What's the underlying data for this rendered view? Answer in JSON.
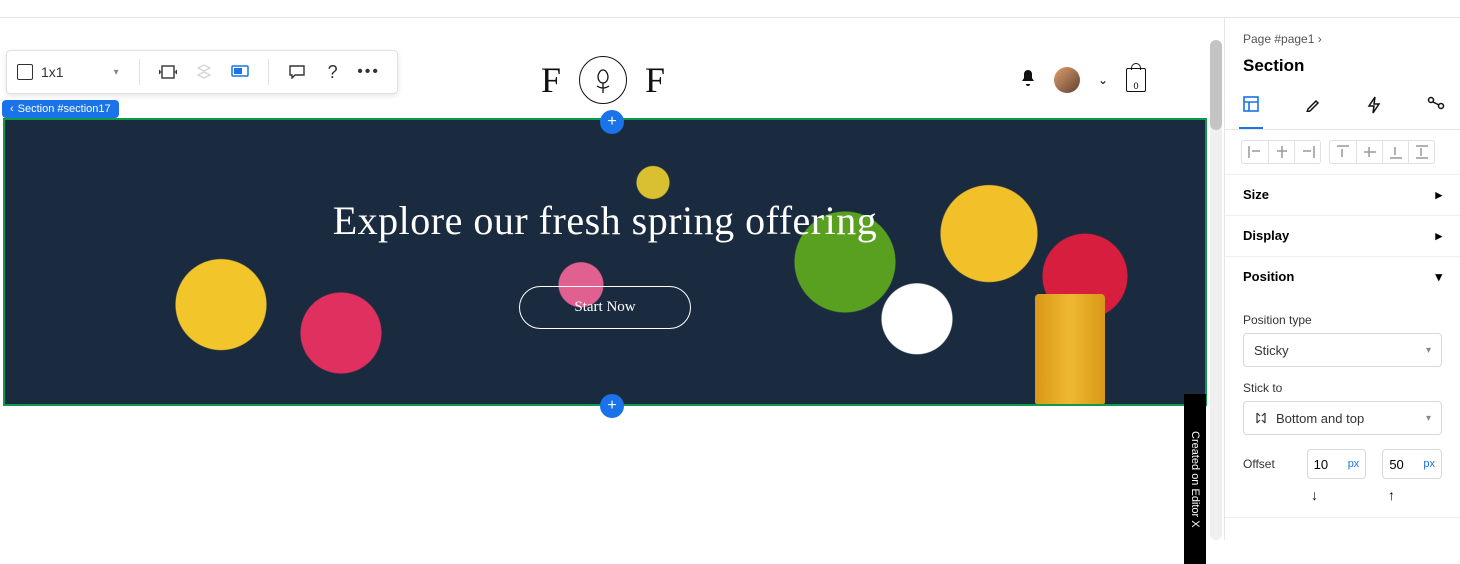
{
  "toolbar": {
    "grid": "1x1",
    "question": "?"
  },
  "site": {
    "letterLeft": "F",
    "letterRight": "F",
    "bagCount": "0"
  },
  "crumb": "Section #section17",
  "hero": {
    "headline": "Explore our fresh spring offering",
    "cta": "Start Now"
  },
  "editorx": "Created on Editor X",
  "panel": {
    "breadcrumb": "Page #page1",
    "title": "Section",
    "accordions": {
      "size": "Size",
      "display": "Display",
      "position": "Position"
    },
    "position": {
      "typeLabel": "Position type",
      "typeValue": "Sticky",
      "stickLabel": "Stick to",
      "stickValue": "Bottom and top",
      "offsetLabel": "Offset",
      "offset1": "10",
      "offset2": "50",
      "unit": "px"
    }
  }
}
